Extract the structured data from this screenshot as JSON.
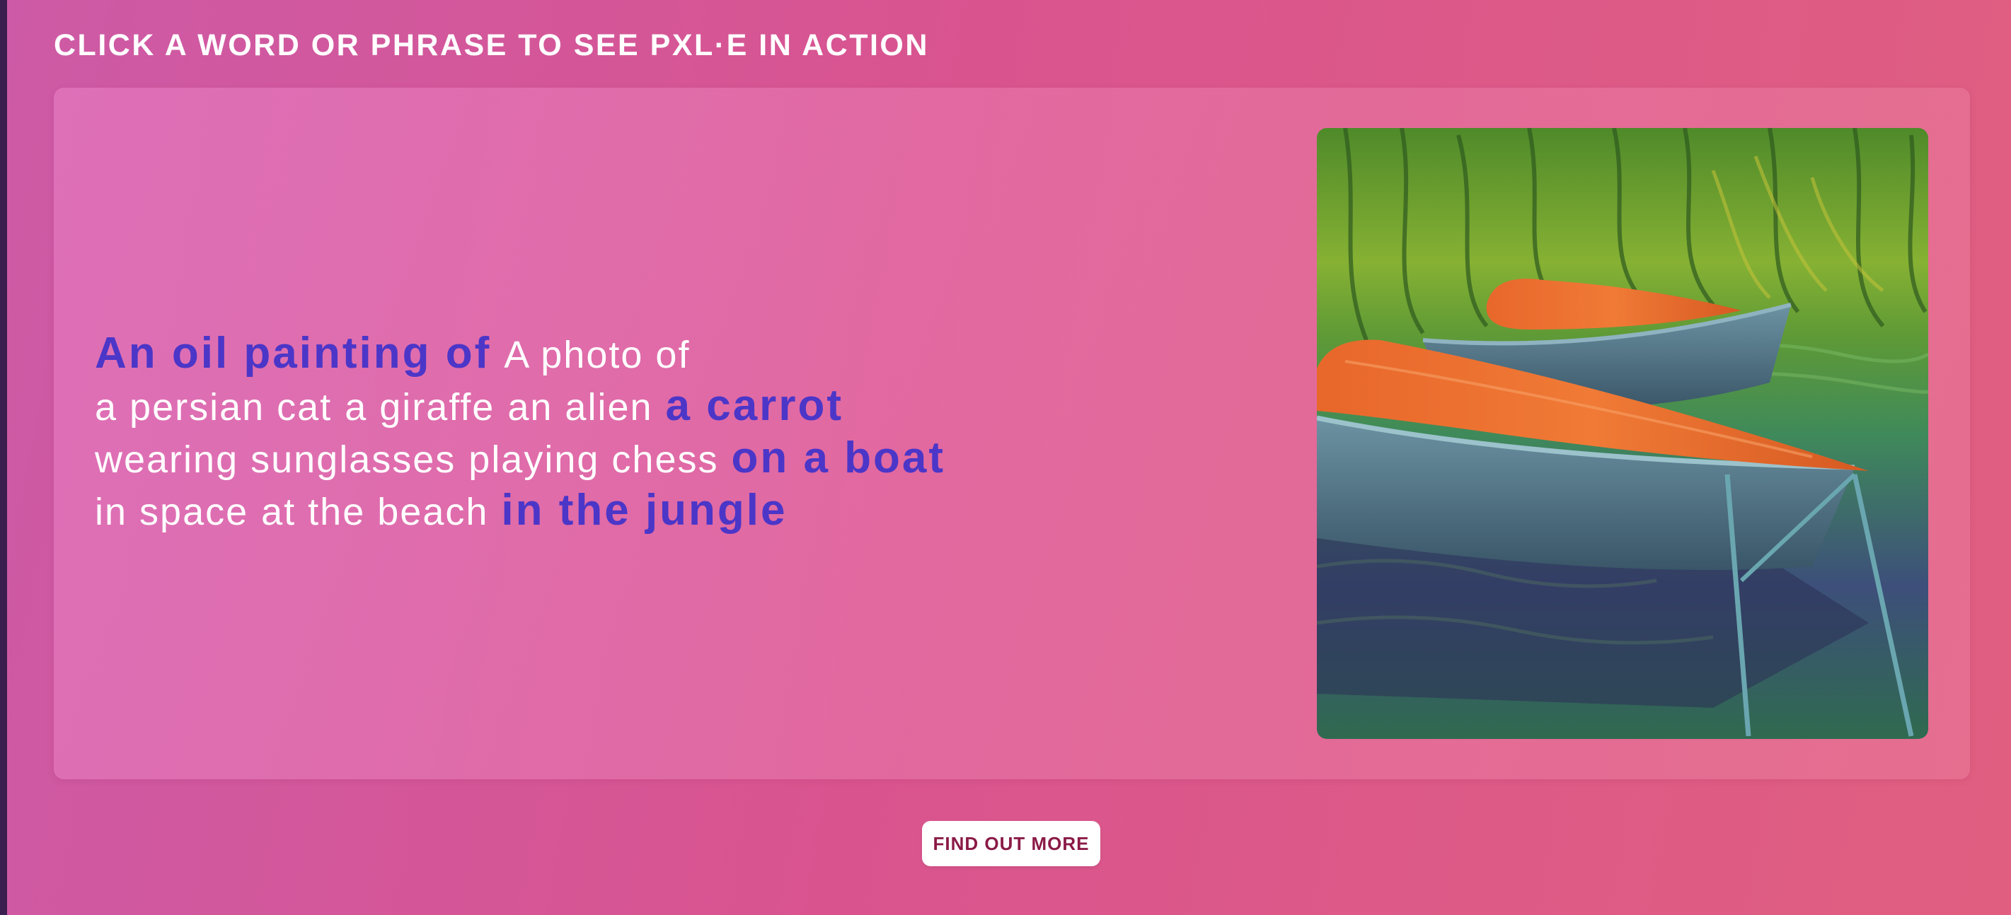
{
  "heading": "CLICK A WORD OR PHRASE TO SEE PXL·E IN ACTION",
  "prompt": {
    "rows": [
      [
        {
          "text": "An oil painting of",
          "selected": true
        },
        {
          "text": "A photo of",
          "selected": false
        }
      ],
      [
        {
          "text": "a persian cat",
          "selected": false
        },
        {
          "text": "a giraffe",
          "selected": false
        },
        {
          "text": "an alien",
          "selected": false
        },
        {
          "text": "a carrot",
          "selected": true
        }
      ],
      [
        {
          "text": "wearing sunglasses",
          "selected": false
        },
        {
          "text": "playing chess",
          "selected": false
        },
        {
          "text": "on a boat",
          "selected": true
        }
      ],
      [
        {
          "text": "in space",
          "selected": false
        },
        {
          "text": "at the beach",
          "selected": false
        },
        {
          "text": "in the jungle",
          "selected": true
        }
      ]
    ]
  },
  "image": {
    "subject": "oil painting of carrots on boats in the jungle"
  },
  "cta": {
    "label": "FIND OUT MORE"
  },
  "colors": {
    "accent": "#4b36c8",
    "cta_text": "#8a1a46"
  }
}
